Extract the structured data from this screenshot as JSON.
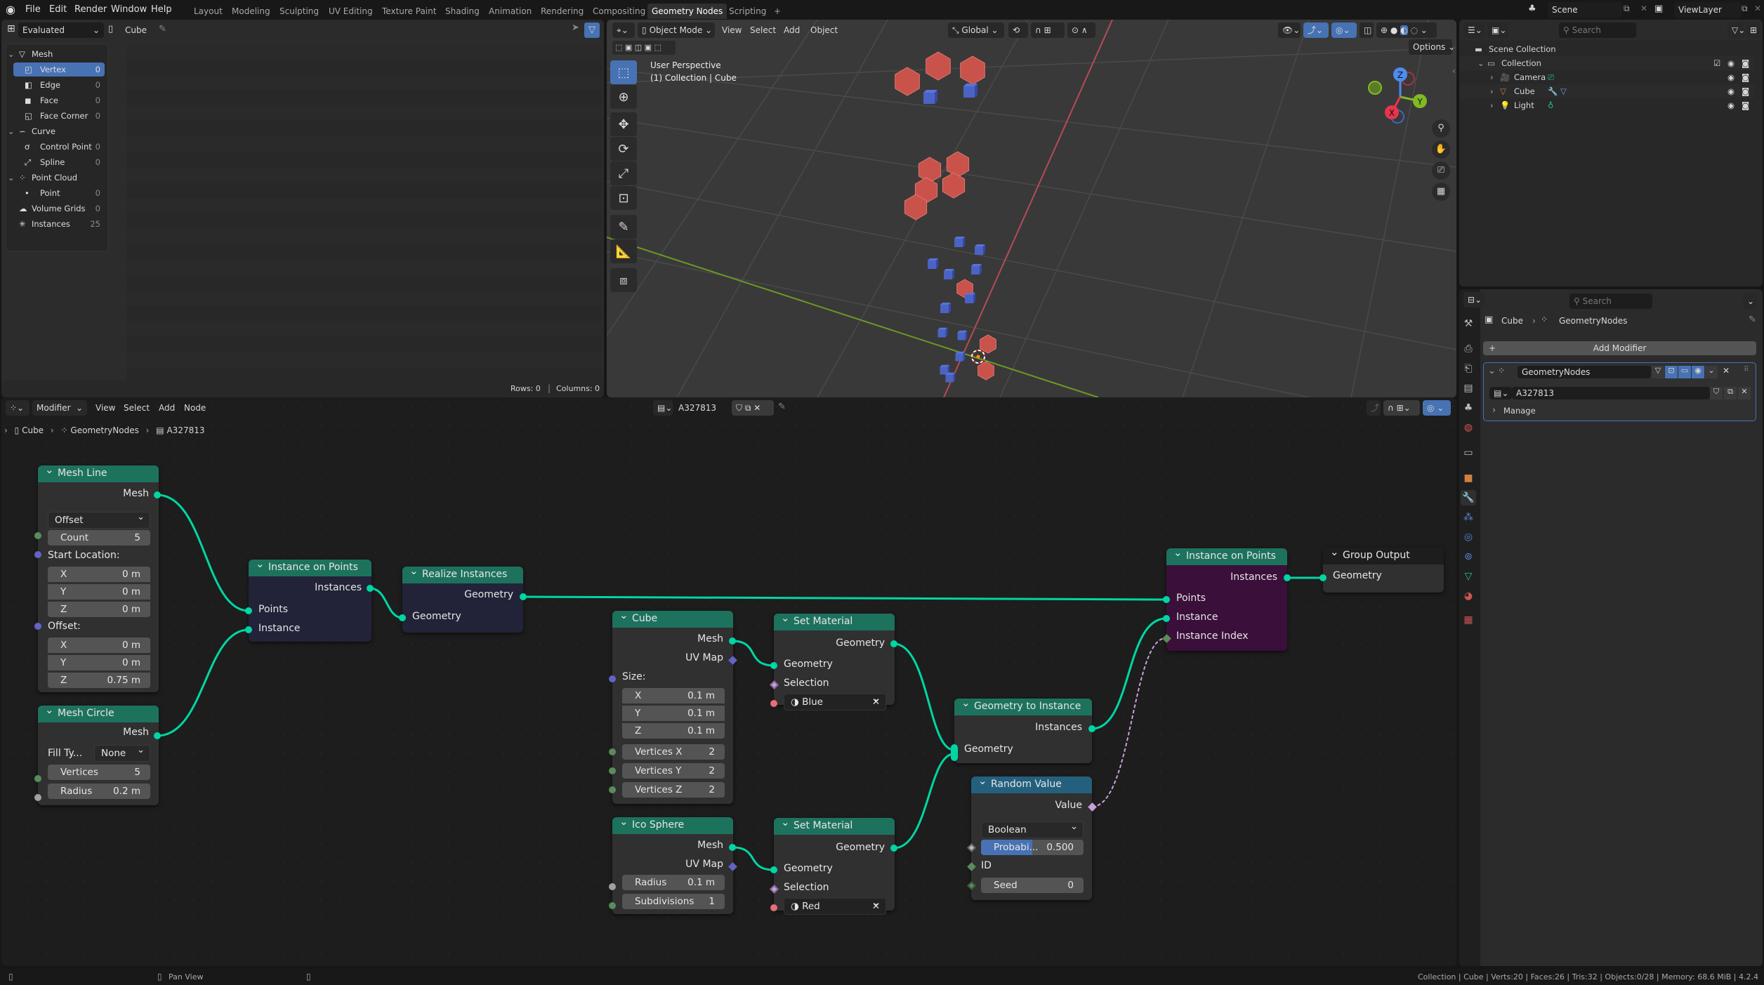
{
  "topbar": {
    "menus": [
      "File",
      "Edit",
      "Render",
      "Window",
      "Help"
    ],
    "workspaces": [
      "Layout",
      "Modeling",
      "Sculpting",
      "UV Editing",
      "Texture Paint",
      "Shading",
      "Animation",
      "Rendering",
      "Compositing",
      "Geometry Nodes",
      "Scripting"
    ],
    "active_workspace": "Geometry Nodes",
    "add_workspace": "+",
    "scene": "Scene",
    "view_layer": "ViewLayer"
  },
  "spreadsheet": {
    "display_mode": "Evaluated",
    "object": "Cube",
    "tree": [
      {
        "label": "Mesh",
        "count": "",
        "level": 0,
        "expanded": true
      },
      {
        "label": "Vertex",
        "count": "0",
        "level": 1,
        "selected": true
      },
      {
        "label": "Edge",
        "count": "0",
        "level": 1
      },
      {
        "label": "Face",
        "count": "0",
        "level": 1
      },
      {
        "label": "Face Corner",
        "count": "0",
        "level": 1
      },
      {
        "label": "Curve",
        "count": "",
        "level": 0,
        "expanded": true
      },
      {
        "label": "Control Point",
        "count": "0",
        "level": 1
      },
      {
        "label": "Spline",
        "count": "0",
        "level": 1
      },
      {
        "label": "Point Cloud",
        "count": "",
        "level": 0,
        "expanded": true
      },
      {
        "label": "Point",
        "count": "0",
        "level": 1
      },
      {
        "label": "Volume Grids",
        "count": "0",
        "level": 0
      },
      {
        "label": "Instances",
        "count": "25",
        "level": 0
      }
    ],
    "rows_label": "Rows: 0",
    "columns_label": "Columns: 0"
  },
  "viewport": {
    "mode": "Object Mode",
    "menus": [
      "View",
      "Select",
      "Add",
      "Object"
    ],
    "orientation": "Global",
    "options_label": "Options",
    "overlay_title": "User Perspective",
    "overlay_subtitle": "(1) Collection | Cube",
    "gizmo_axes": [
      "X",
      "Y",
      "Z"
    ],
    "tools": [
      "select-box",
      "cursor",
      "move",
      "rotate",
      "scale",
      "transform",
      "annotate",
      "measure",
      "add-cube"
    ]
  },
  "outliner": {
    "search_placeholder": "Search",
    "items": [
      {
        "label": "Scene Collection",
        "level": 0
      },
      {
        "label": "Collection",
        "level": 1
      },
      {
        "label": "Camera",
        "level": 2
      },
      {
        "label": "Cube",
        "level": 2
      },
      {
        "label": "Light",
        "level": 2
      }
    ]
  },
  "properties": {
    "search_placeholder": "Search",
    "breadcrumb_object": "Cube",
    "breadcrumb_modifier": "GeometryNodes",
    "add_modifier": "Add Modifier",
    "modifier_name": "GeometryNodes",
    "node_group": "A327813",
    "manage_label": "Manage"
  },
  "node_editor": {
    "editor_type": "Modifier",
    "menus": [
      "View",
      "Select",
      "Add",
      "Node"
    ],
    "node_group": "A327813",
    "breadcrumb": [
      "Cube",
      "GeometryNodes",
      "A327813"
    ],
    "nodes": {
      "mesh_line": {
        "title": "Mesh Line",
        "out": "Mesh",
        "mode": "Offset",
        "count_label": "Count",
        "count": "5",
        "start_label": "Start Location:",
        "start": [
          [
            "X",
            "0 m"
          ],
          [
            "Y",
            "0 m"
          ],
          [
            "Z",
            "0 m"
          ]
        ],
        "offset_label": "Offset:",
        "offset": [
          [
            "X",
            "0 m"
          ],
          [
            "Y",
            "0 m"
          ],
          [
            "Z",
            "0.75 m"
          ]
        ]
      },
      "mesh_circle": {
        "title": "Mesh Circle",
        "out": "Mesh",
        "fill_label": "Fill Ty...",
        "fill": "None",
        "vertices_label": "Vertices",
        "vertices": "5",
        "radius_label": "Radius",
        "radius": "0.2 m"
      },
      "iop1": {
        "title": "Instance on Points",
        "out": "Instances",
        "in1": "Points",
        "in2": "Instance"
      },
      "realize": {
        "title": "Realize Instances",
        "out": "Geometry",
        "in": "Geometry"
      },
      "cube": {
        "title": "Cube",
        "out1": "Mesh",
        "out2": "UV Map",
        "size_label": "Size:",
        "size": [
          [
            "X",
            "0.1 m"
          ],
          [
            "Y",
            "0.1 m"
          ],
          [
            "Z",
            "0.1 m"
          ]
        ],
        "verts": [
          [
            "Vertices X",
            "2"
          ],
          [
            "Vertices Y",
            "2"
          ],
          [
            "Vertices Z",
            "2"
          ]
        ]
      },
      "ico": {
        "title": "Ico Sphere",
        "out1": "Mesh",
        "out2": "UV Map",
        "radius_label": "Radius",
        "radius": "0.1 m",
        "subdiv_label": "Subdivisions",
        "subdiv": "1"
      },
      "setmat1": {
        "title": "Set Material",
        "out": "Geometry",
        "in1": "Geometry",
        "in2": "Selection",
        "material": "Blue"
      },
      "setmat2": {
        "title": "Set Material",
        "out": "Geometry",
        "in1": "Geometry",
        "in2": "Selection",
        "material": "Red"
      },
      "geo2inst": {
        "title": "Geometry to Instance",
        "out": "Instances",
        "in": "Geometry"
      },
      "random": {
        "title": "Random Value",
        "out": "Value",
        "type": "Boolean",
        "prob_label": "Probabi...",
        "prob": "0.500",
        "prob_fraction": 0.5,
        "id_label": "ID",
        "seed_label": "Seed",
        "seed": "0"
      },
      "iop2": {
        "title": "Instance on Points",
        "out": "Instances",
        "in1": "Points",
        "in2": "Instance",
        "in3": "Instance Index"
      },
      "group_output": {
        "title": "Group Output",
        "in": "Geometry"
      }
    }
  },
  "statusbar": {
    "pan_label": "Pan View",
    "stats": "Collection | Cube | Verts:20 | Faces:26 | Tris:32 | Objects:0/28 | Memory: 68.6 MiB | 4.2.4"
  },
  "colors": {
    "accent": "#4772b3",
    "geometry_socket": "#00d6a3",
    "node_header_geo": "#1d725e",
    "node_header_util": "#24607e"
  }
}
